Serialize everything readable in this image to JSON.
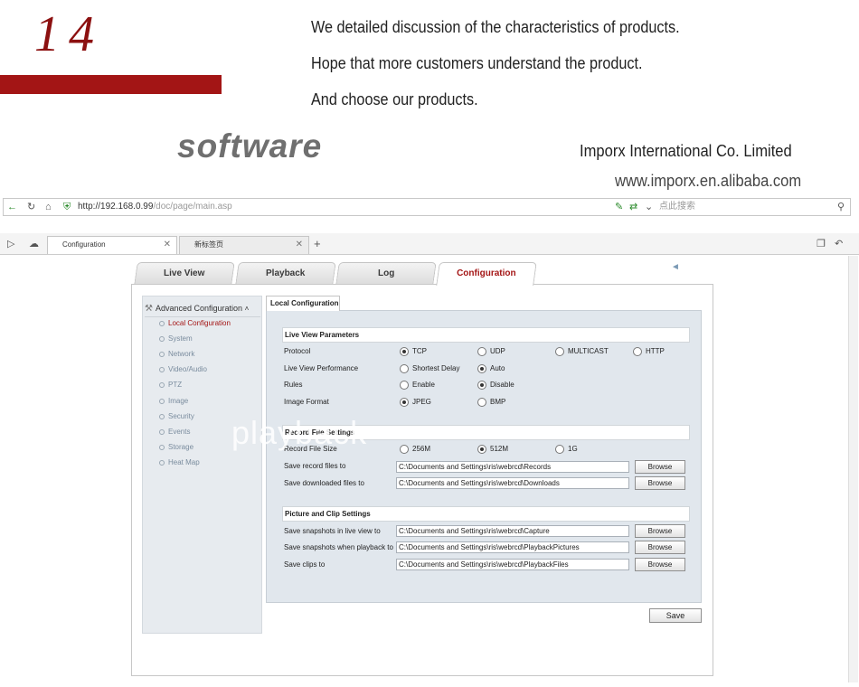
{
  "banner": {
    "number": "14",
    "line1": "We detailed discussion of the characteristics of products.",
    "line2": "Hope that more customers understand the product.",
    "line3": "And choose our products.",
    "software": "software",
    "company": "Imporx International Co. Limited",
    "website": "www.imporx.en.alibaba.com"
  },
  "browser": {
    "url_host": "http://192.168.0.99",
    "url_path": "/doc/page/main.asp",
    "search_placeholder": "点此搜索",
    "tabs": [
      {
        "label": "Configuration",
        "active": true
      },
      {
        "label": "新标签页",
        "active": false
      }
    ],
    "new_tab": "+"
  },
  "app": {
    "tabs": [
      {
        "label": "Live View"
      },
      {
        "label": "Playback"
      },
      {
        "label": "Log"
      },
      {
        "label": "Configuration",
        "active": true
      }
    ],
    "sidebar": {
      "header": "Advanced Configuration",
      "items": [
        "Local Configuration",
        "System",
        "Network",
        "Video/Audio",
        "PTZ",
        "Image",
        "Security",
        "Events",
        "Storage",
        "Heat Map"
      ]
    },
    "content_tab": "Local Configuration",
    "live_view": {
      "header": "Live View Parameters",
      "protocol_label": "Protocol",
      "protocol_options": [
        "TCP",
        "UDP",
        "MULTICAST",
        "HTTP"
      ],
      "performance_label": "Live View Performance",
      "performance_options": [
        "Shortest Delay",
        "Auto"
      ],
      "rules_label": "Rules",
      "rules_options": [
        "Enable",
        "Disable"
      ],
      "format_label": "Image Format",
      "format_options": [
        "JPEG",
        "BMP"
      ]
    },
    "record": {
      "header": "Record File Settings",
      "size_label": "Record File Size",
      "size_options": [
        "256M",
        "512M",
        "1G"
      ],
      "save_record_label": "Save record files to",
      "save_record_path": "C:\\Documents and Settings\\ris\\webrcd\\Records",
      "save_download_label": "Save downloaded files to",
      "save_download_path": "C:\\Documents and Settings\\ris\\webrcd\\Downloads"
    },
    "picture": {
      "header": "Picture and Clip Settings",
      "snap_live_label": "Save snapshots in live view to",
      "snap_live_path": "C:\\Documents and Settings\\ris\\webrcd\\Capture",
      "snap_play_label": "Save snapshots when playback to",
      "snap_play_path": "C:\\Documents and Settings\\ris\\webrcd\\PlaybackPictures",
      "clips_label": "Save clips to",
      "clips_path": "C:\\Documents and Settings\\ris\\webrcd\\PlaybackFiles"
    },
    "browse_label": "Browse",
    "save_label": "Save",
    "watermark": "playback"
  },
  "colors": {
    "accent": "#a31515",
    "panel": "#e1e7ed"
  }
}
